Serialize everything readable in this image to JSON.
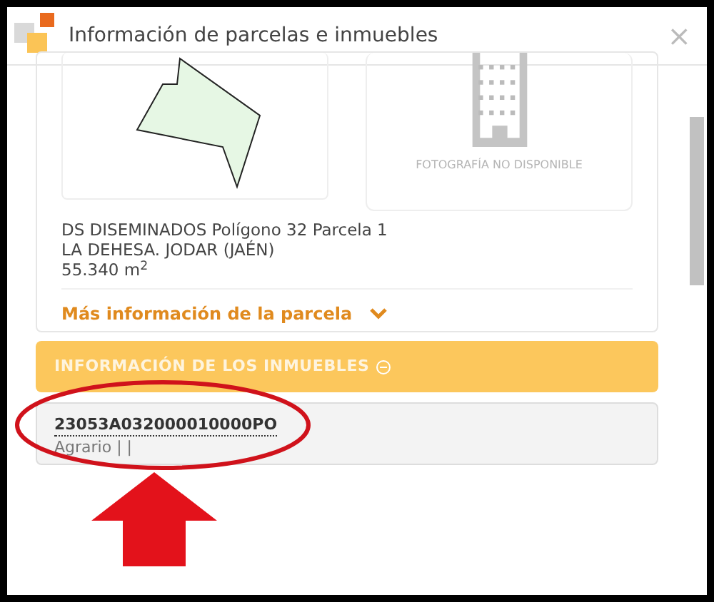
{
  "window": {
    "title": "Información de parcelas e inmuebles",
    "close": "×"
  },
  "parcel": {
    "photo_caption": "FOTOGRAFÍA NO DISPONIBLE",
    "address_lines": [
      "DS DISEMINADOS Polígono 32 Parcela 1",
      "LA DEHESA. JODAR (JAÉN)",
      "55.340 m$^{2}$"
    ],
    "more_link": "Más información de la parcela",
    "expanded": false
  },
  "properties": {
    "header": "INFORMACIÓN DE LOS INMUEBLES",
    "expanded": true,
    "items": [
      {
        "reference": "23053A032000010000PO",
        "detail": "Agrario | |"
      }
    ]
  }
}
